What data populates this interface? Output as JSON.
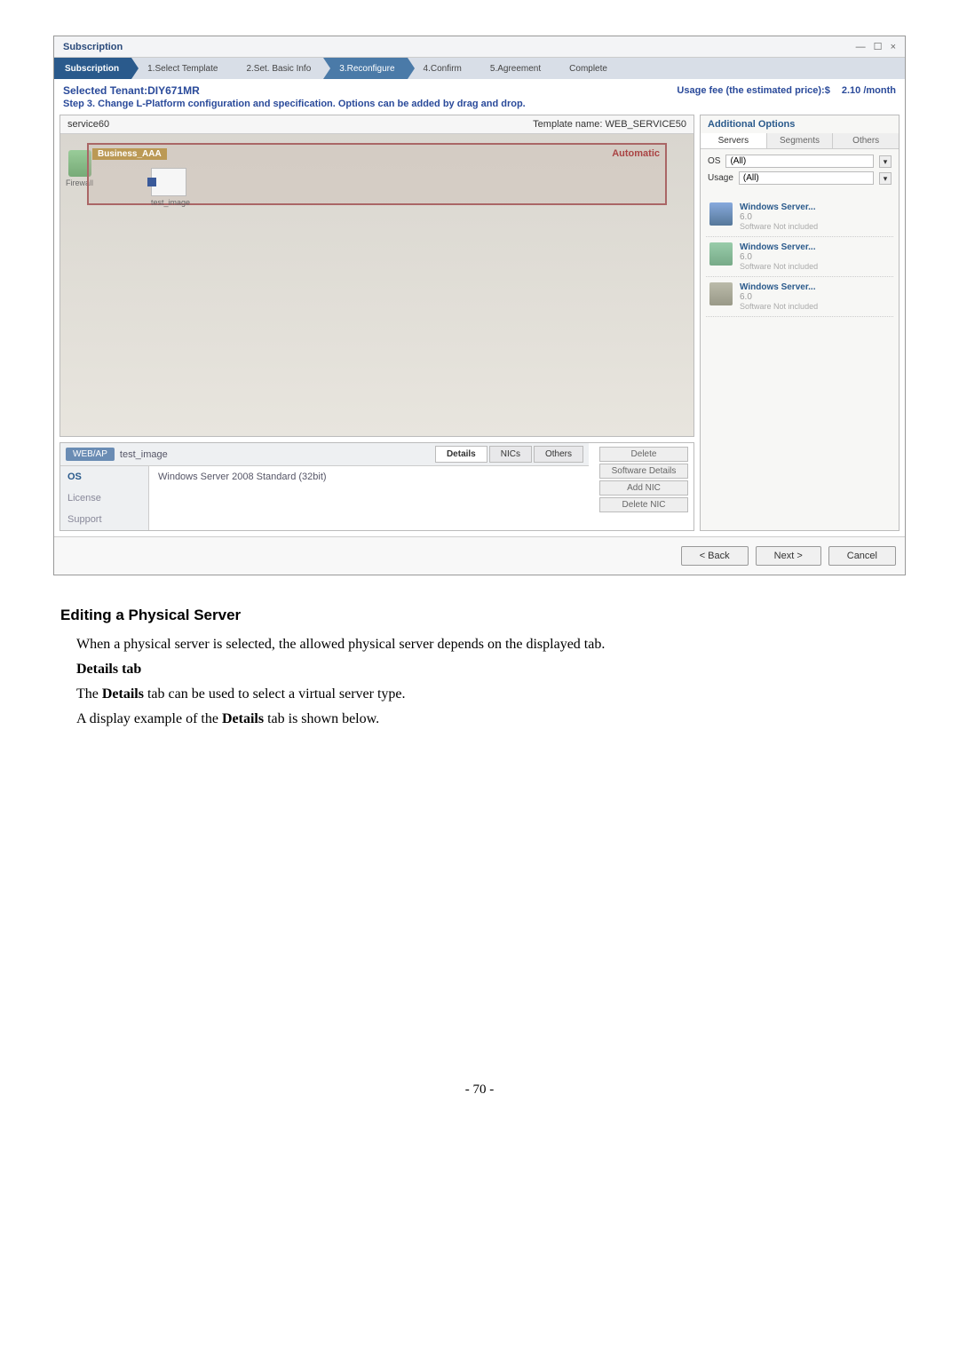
{
  "window": {
    "title": "Subscription"
  },
  "breadcrumb": {
    "root": "Subscription",
    "steps": [
      "1.Select Template",
      "2.Set. Basic Info",
      "3.Reconfigure",
      "4.Confirm",
      "5.Agreement",
      "Complete"
    ]
  },
  "header": {
    "tenant_label": "Selected Tenant:DIY671MR",
    "usage_label": "Usage fee (the estimated price):$",
    "usage_value": "2.10 /month",
    "step_desc": "Step 3. Change L-Platform configuration and specification. Options can be added by drag and drop."
  },
  "canvas": {
    "service_name": "service60",
    "template_label": "Template name: WEB_SERVICE50",
    "group_title": "Business_AAA",
    "group_badge": "Automatic",
    "firewall_label": "Firewall",
    "node_label": "test_image"
  },
  "detail": {
    "tag": "WEB/AP",
    "name": "test_image",
    "tabs": {
      "details": "Details",
      "nics": "NICs",
      "others": "Others"
    },
    "side_buttons": {
      "delete": "Delete",
      "sw_details": "Software Details",
      "add_nic": "Add NIC",
      "del_nic": "Delete NIC"
    },
    "left": {
      "os": "OS",
      "license": "License",
      "support": "Support"
    },
    "os_value": "Windows Server 2008 Standard (32bit)"
  },
  "options": {
    "title": "Additional Options",
    "tabs": {
      "servers": "Servers",
      "segments": "Segments",
      "others": "Others"
    },
    "filters": {
      "os_label": "OS",
      "os_value": "(All)",
      "usage_label": "Usage",
      "usage_value": "(All)"
    },
    "items": [
      {
        "title": "Windows Server...",
        "sub": "6.0",
        "sw_lbl": "Software",
        "sw_val": "Not included"
      },
      {
        "title": "Windows Server...",
        "sub": "6.0",
        "sw_lbl": "Software",
        "sw_val": "Not included"
      },
      {
        "title": "Windows Server...",
        "sub": "6.0",
        "sw_lbl": "Software",
        "sw_val": "Not included"
      }
    ]
  },
  "footer": {
    "back": "< Back",
    "next": "Next >",
    "cancel": "Cancel"
  },
  "doc": {
    "heading": "Editing a Physical Server",
    "p1": "When a physical server is selected, the allowed physical server depends on the displayed tab.",
    "sub1": "Details tab",
    "p2_a": "The ",
    "p2_b": "Details",
    "p2_c": " tab can be used to select a virtual server type.",
    "p3_a": "A display example of the ",
    "p3_b": "Details",
    "p3_c": " tab is shown below.",
    "page": "- 70 -"
  }
}
